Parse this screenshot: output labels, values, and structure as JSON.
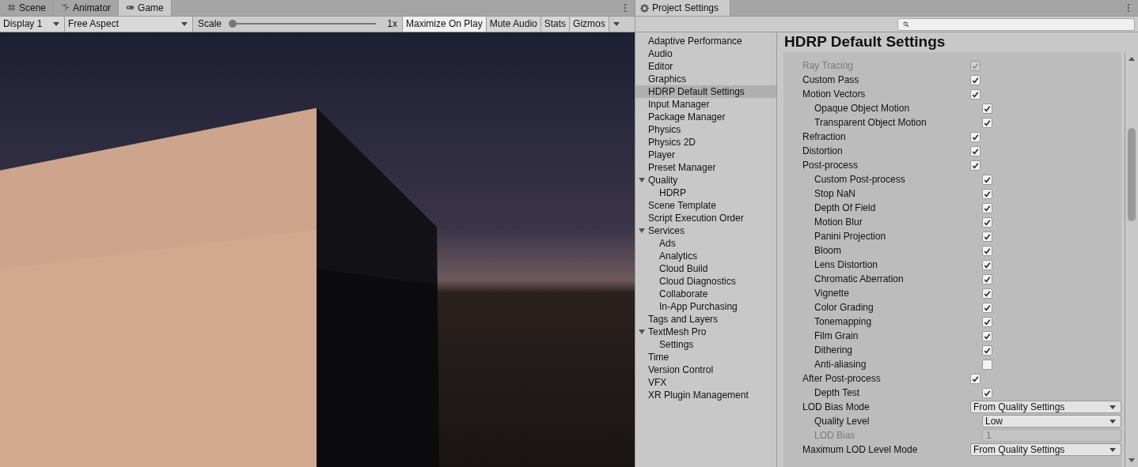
{
  "game_panel": {
    "tabs": [
      {
        "label": "Scene",
        "selected": false
      },
      {
        "label": "Animator",
        "selected": false
      },
      {
        "label": "Game",
        "selected": true
      }
    ],
    "toolbar": {
      "display": "Display 1",
      "aspect": "Free Aspect",
      "scale_label": "Scale",
      "scale": {
        "level": 0
      },
      "scale_value": "1x",
      "toggles": [
        {
          "label": "Maximize On Play",
          "on": true
        },
        {
          "label": "Mute Audio",
          "on": false
        },
        {
          "label": "Stats",
          "on": false
        },
        {
          "label": "Gizmos",
          "on": false
        }
      ]
    }
  },
  "settings_panel": {
    "tab": {
      "label": "Project Settings"
    },
    "sidebar": [
      {
        "label": "Adaptive Performance",
        "selected": false
      },
      {
        "label": "Audio",
        "selected": false
      },
      {
        "label": "Editor",
        "selected": false
      },
      {
        "label": "Graphics",
        "selected": false
      },
      {
        "label": "HDRP Default Settings",
        "selected": true
      },
      {
        "label": "Input Manager",
        "selected": false
      },
      {
        "label": "Package Manager",
        "selected": false
      },
      {
        "label": "Physics",
        "selected": false
      },
      {
        "label": "Physics 2D",
        "selected": false
      },
      {
        "label": "Player",
        "selected": false
      },
      {
        "label": "Preset Manager",
        "selected": false
      },
      {
        "label": "Quality",
        "selected": false,
        "expanded": true,
        "children": [
          {
            "label": "HDRP",
            "selected": false
          }
        ]
      },
      {
        "label": "Scene Template",
        "selected": false
      },
      {
        "label": "Script Execution Order",
        "selected": false
      },
      {
        "label": "Services",
        "selected": false,
        "expanded": true,
        "children": [
          {
            "label": "Ads",
            "selected": false
          },
          {
            "label": "Analytics",
            "selected": false
          },
          {
            "label": "Cloud Build",
            "selected": false
          },
          {
            "label": "Cloud Diagnostics",
            "selected": false
          },
          {
            "label": "Collaborate",
            "selected": false
          },
          {
            "label": "In-App Purchasing",
            "selected": false
          }
        ]
      },
      {
        "label": "Tags and Layers",
        "selected": false
      },
      {
        "label": "TextMesh Pro",
        "selected": false,
        "expanded": true,
        "children": [
          {
            "label": "Settings",
            "selected": false
          }
        ]
      },
      {
        "label": "Time",
        "selected": false
      },
      {
        "label": "Version Control",
        "selected": false
      },
      {
        "label": "VFX",
        "selected": false
      },
      {
        "label": "XR Plugin Management",
        "selected": false
      }
    ],
    "title": "HDRP Default Settings",
    "rows": [
      {
        "label": "Ray Tracing",
        "kind": "checkbox",
        "checked": true,
        "disabled": true
      },
      {
        "label": "Custom Pass",
        "kind": "checkbox",
        "checked": true,
        "disabled": false
      },
      {
        "label": "Motion Vectors",
        "kind": "checkbox",
        "checked": true,
        "disabled": false,
        "children": [
          {
            "label": "Opaque Object Motion",
            "kind": "checkbox",
            "checked": true,
            "disabled": false
          },
          {
            "label": "Transparent Object Motion",
            "kind": "checkbox",
            "checked": true,
            "disabled": false
          }
        ]
      },
      {
        "label": "Refraction",
        "kind": "checkbox",
        "checked": true,
        "disabled": false
      },
      {
        "label": "Distortion",
        "kind": "checkbox",
        "checked": true,
        "disabled": false
      },
      {
        "label": "Post-process",
        "kind": "checkbox",
        "checked": true,
        "disabled": false,
        "children": [
          {
            "label": "Custom Post-process",
            "kind": "checkbox",
            "checked": true,
            "disabled": false
          },
          {
            "label": "Stop NaN",
            "kind": "checkbox",
            "checked": true,
            "disabled": false
          },
          {
            "label": "Depth Of Field",
            "kind": "checkbox",
            "checked": true,
            "disabled": false
          },
          {
            "label": "Motion Blur",
            "kind": "checkbox",
            "checked": true,
            "disabled": false
          },
          {
            "label": "Panini Projection",
            "kind": "checkbox",
            "checked": true,
            "disabled": false
          },
          {
            "label": "Bloom",
            "kind": "checkbox",
            "checked": true,
            "disabled": false
          },
          {
            "label": "Lens Distortion",
            "kind": "checkbox",
            "checked": true,
            "disabled": false
          },
          {
            "label": "Chromatic Aberration",
            "kind": "checkbox",
            "checked": true,
            "disabled": false
          },
          {
            "label": "Vignette",
            "kind": "checkbox",
            "checked": true,
            "disabled": false
          },
          {
            "label": "Color Grading",
            "kind": "checkbox",
            "checked": true,
            "disabled": false
          },
          {
            "label": "Tonemapping",
            "kind": "checkbox",
            "checked": true,
            "disabled": false
          },
          {
            "label": "Film Grain",
            "kind": "checkbox",
            "checked": true,
            "disabled": false
          },
          {
            "label": "Dithering",
            "kind": "checkbox",
            "checked": true,
            "disabled": false
          },
          {
            "label": "Anti-aliasing",
            "kind": "checkbox",
            "checked": false,
            "disabled": false
          }
        ]
      },
      {
        "label": "After Post-process",
        "kind": "checkbox",
        "checked": true,
        "disabled": false,
        "children": [
          {
            "label": "Depth Test",
            "kind": "checkbox",
            "checked": true,
            "disabled": false
          }
        ]
      },
      {
        "label": "LOD Bias Mode",
        "kind": "dropdown",
        "value": "From Quality Settings",
        "children": [
          {
            "label": "Quality Level",
            "kind": "dropdown",
            "value": "Low"
          },
          {
            "label": "LOD Bias",
            "kind": "field",
            "value": "1",
            "disabled": true
          }
        ]
      },
      {
        "label": "Maximum LOD Level Mode",
        "kind": "dropdown",
        "value": "From Quality Settings"
      }
    ]
  }
}
